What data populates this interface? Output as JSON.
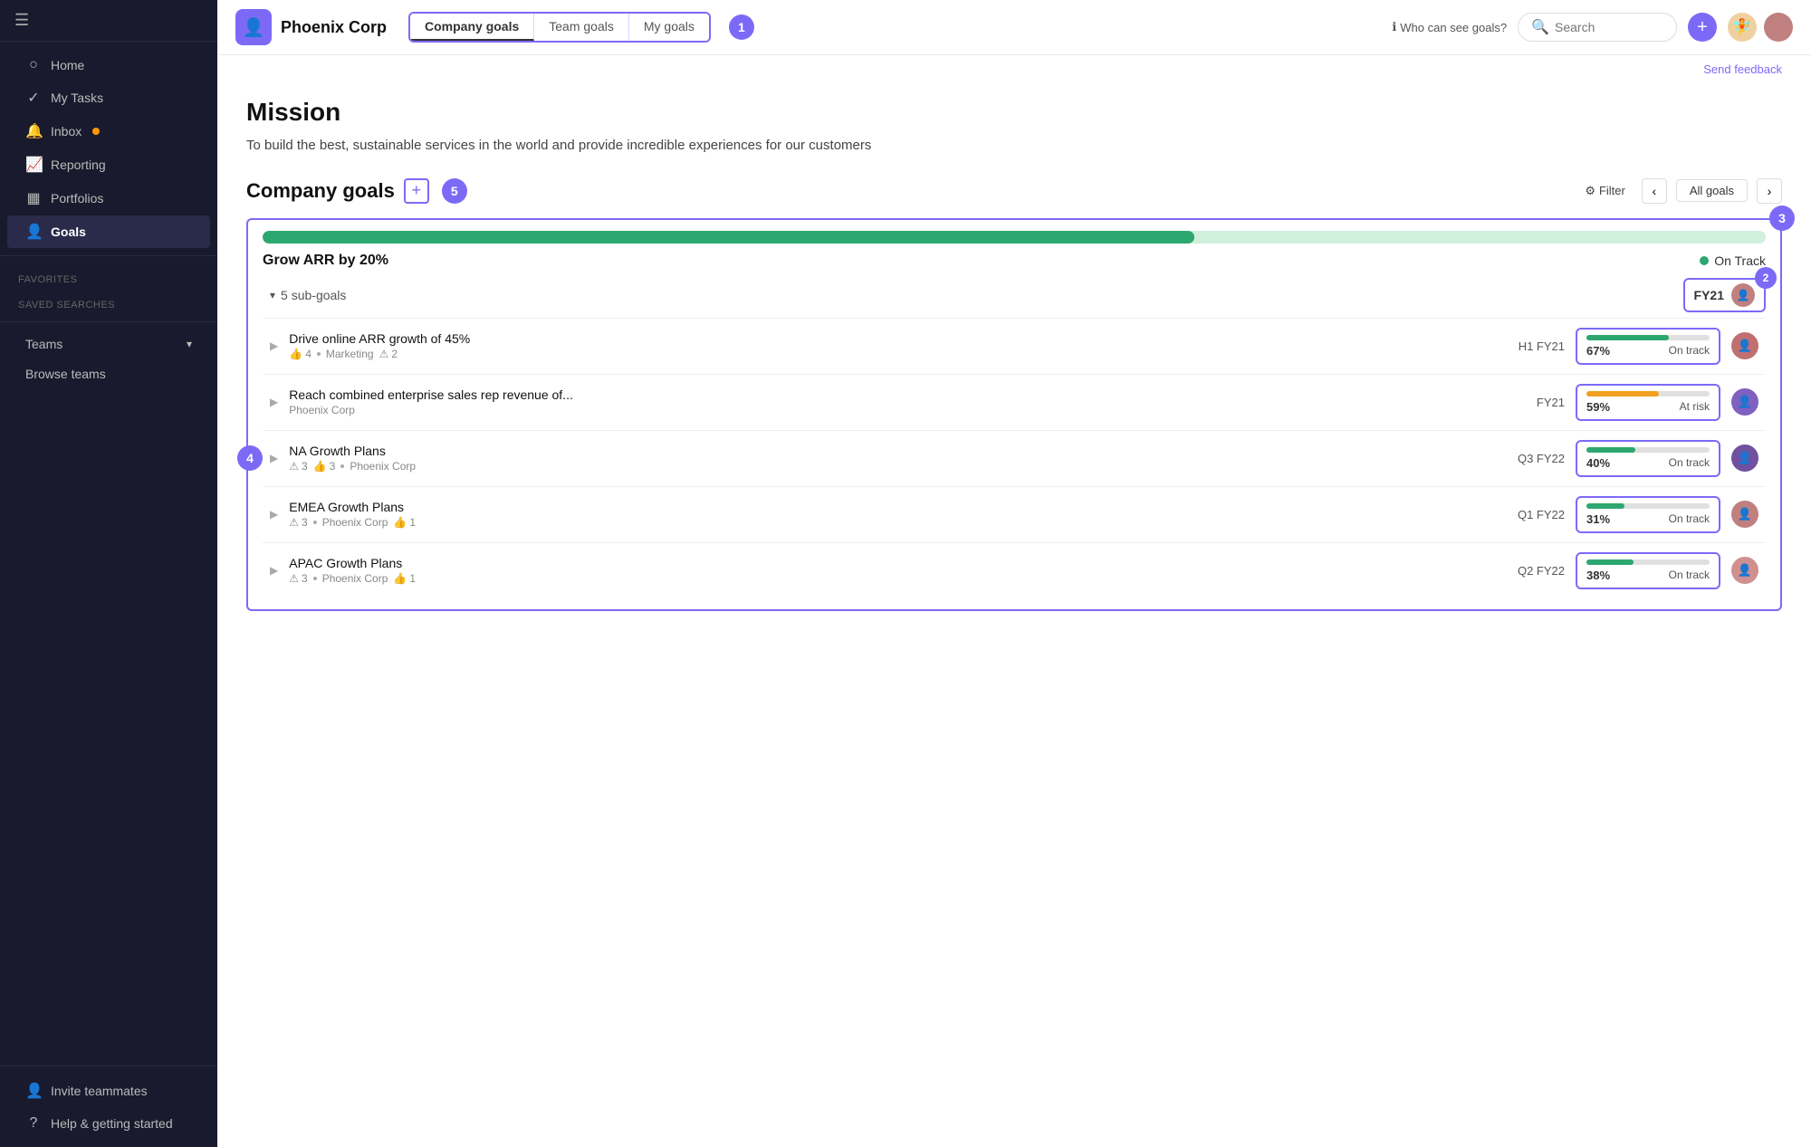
{
  "sidebar": {
    "hamburger": "☰",
    "items": [
      {
        "id": "home",
        "label": "Home",
        "icon": "⌂"
      },
      {
        "id": "my-tasks",
        "label": "My Tasks",
        "icon": "✓"
      },
      {
        "id": "inbox",
        "label": "Inbox",
        "icon": "🔔",
        "has_badge": true
      },
      {
        "id": "reporting",
        "label": "Reporting",
        "icon": "📈"
      },
      {
        "id": "portfolios",
        "label": "Portfolios",
        "icon": "▦"
      },
      {
        "id": "goals",
        "label": "Goals",
        "icon": "👤",
        "active": true
      }
    ],
    "favorites_label": "Favorites",
    "saved_searches_label": "Saved searches",
    "teams_label": "Teams",
    "browse_teams_label": "Browse teams",
    "invite_label": "Invite teammates",
    "help_label": "Help & getting started"
  },
  "topbar": {
    "org_name": "Phoenix Corp",
    "tabs": [
      {
        "id": "company",
        "label": "Company goals",
        "active": true
      },
      {
        "id": "team",
        "label": "Team goals",
        "active": false
      },
      {
        "id": "my",
        "label": "My goals",
        "active": false
      }
    ],
    "annotation_1": "1",
    "who_can_see_label": "Who can see goals?",
    "search_placeholder": "Search",
    "add_icon": "+",
    "send_feedback_label": "Send feedback"
  },
  "mission": {
    "title": "Mission",
    "text": "To build the best, sustainable services in the world and provide incredible experiences for our customers"
  },
  "company_goals": {
    "title": "Company goals",
    "add_icon": "+",
    "count": "5",
    "annotation_5": "5",
    "filter_label": "Filter",
    "all_goals_label": "All goals",
    "main_goal": {
      "title": "Grow ARR by 20%",
      "progress": 62,
      "status": "On Track",
      "annotation_3": "3",
      "period": "FY21",
      "annotation_2": "2"
    },
    "sub_goals_label": "5 sub-goals",
    "annotation_4": "4",
    "sub_goals": [
      {
        "name": "Drive online ARR growth of 45%",
        "likes": "4",
        "warnings": "2",
        "team": "Marketing",
        "period": "H1 FY21",
        "pct": "67%",
        "pct_num": 67,
        "status": "On track",
        "bar_color": "#2da770",
        "avatar_color": "#c07070"
      },
      {
        "name": "Reach combined enterprise sales rep revenue of...",
        "likes": "",
        "warnings": "",
        "team": "Phoenix Corp",
        "period": "FY21",
        "pct": "59%",
        "pct_num": 59,
        "status": "At risk",
        "bar_color": "#f0a020",
        "avatar_color": "#8060c0"
      },
      {
        "name": "NA Growth Plans",
        "likes": "3",
        "warnings": "3",
        "team": "Phoenix Corp",
        "period": "Q3 FY22",
        "pct": "40%",
        "pct_num": 40,
        "status": "On track",
        "bar_color": "#2da770",
        "avatar_color": "#7050a0"
      },
      {
        "name": "EMEA Growth Plans",
        "likes": "1",
        "warnings": "3",
        "team": "Phoenix Corp",
        "period": "Q1 FY22",
        "pct": "31%",
        "pct_num": 31,
        "status": "On track",
        "bar_color": "#2da770",
        "avatar_color": "#c08080"
      },
      {
        "name": "APAC Growth Plans",
        "likes": "1",
        "warnings": "3",
        "team": "Phoenix Corp",
        "period": "Q2 FY22",
        "pct": "38%",
        "pct_num": 38,
        "status": "On track",
        "bar_color": "#2da770",
        "avatar_color": "#d09090"
      }
    ]
  }
}
